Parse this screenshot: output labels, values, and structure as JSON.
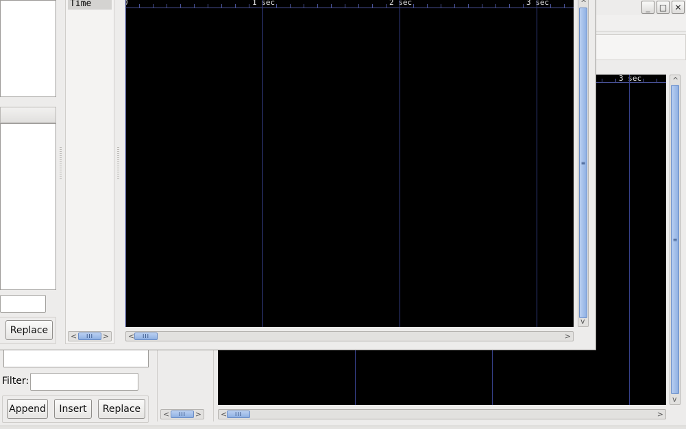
{
  "left_panel": {
    "replace_label": "Replace"
  },
  "lower_panel": {
    "filter_label": "Filter:",
    "filter_value": "",
    "append_label": "Append",
    "insert_label": "Insert",
    "replace_label": "Replace"
  },
  "signals_column": {
    "header": "Time"
  },
  "front_window": {
    "ruler_labels": [
      "0",
      "1 sec",
      "2 sec",
      "3 sec"
    ]
  },
  "back_window": {
    "ruler_labels": [
      "3 sec"
    ]
  },
  "scrollbar": {
    "thumb_grip": "III",
    "vthumb_grip": "≡",
    "left_arrow": "<",
    "right_arrow": ">",
    "up_arrow": "^",
    "down_arrow": "v"
  },
  "window_controls": {
    "minimize": "_",
    "maximize": "□",
    "close": "✕"
  },
  "colors": {
    "wave_bg": "#000000",
    "grid": "#36408a",
    "thumb": "#9bb8e8"
  }
}
